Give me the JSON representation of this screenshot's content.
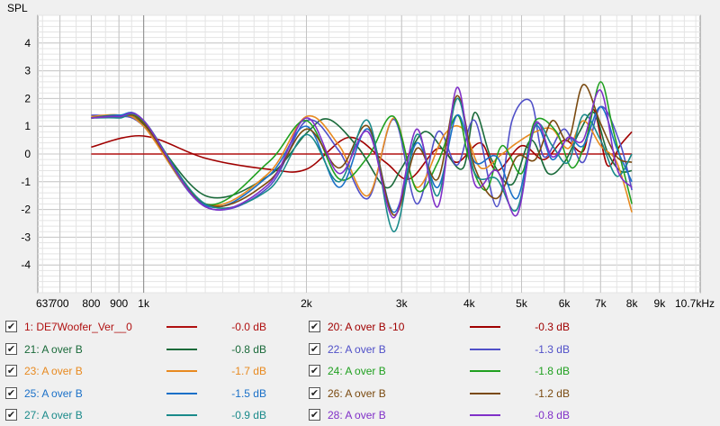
{
  "chart_data": {
    "type": "line",
    "ylabel": "SPL",
    "x_scale": "log",
    "xlim": [
      637,
      10700
    ],
    "ylim": [
      -5,
      5
    ],
    "y_ticks": [
      -4,
      -3,
      -2,
      -1,
      0,
      1,
      2,
      3,
      4
    ],
    "x_ticks": [
      {
        "value": 637,
        "label": "637"
      },
      {
        "value": 700,
        "label": "700"
      },
      {
        "value": 800,
        "label": "800"
      },
      {
        "value": 900,
        "label": "900"
      },
      {
        "value": 1000,
        "label": "1k"
      },
      {
        "value": 2000,
        "label": "2k"
      },
      {
        "value": 3000,
        "label": "3k"
      },
      {
        "value": 4000,
        "label": "4k"
      },
      {
        "value": 5000,
        "label": "5k"
      },
      {
        "value": 6000,
        "label": "6k"
      },
      {
        "value": 7000,
        "label": "7k"
      },
      {
        "value": 8000,
        "label": "8k"
      },
      {
        "value": 9000,
        "label": "9k"
      },
      {
        "value": 10700,
        "label": "10.7kHz"
      }
    ],
    "series": [
      {
        "name": "1: DE7Woofer_Ver__0",
        "color": "#b01010",
        "db": "-0.0 dB",
        "x": [
          800,
          8000
        ],
        "y": [
          0,
          0
        ]
      },
      {
        "name": "20: A over B -10",
        "color": "#a00000",
        "db": "-0.3 dB",
        "x": [
          800,
          1000,
          1300,
          1700,
          2000,
          2400,
          2800,
          3100,
          3500,
          3800,
          4200,
          4500,
          5000,
          5500,
          6000,
          6500,
          6800,
          7200,
          7600,
          8000
        ],
        "y": [
          0.25,
          0.65,
          -0.15,
          -0.55,
          -0.55,
          0.6,
          -0.3,
          -0.9,
          0.2,
          -0.3,
          0.4,
          -0.6,
          0.3,
          -0.2,
          0.5,
          0.1,
          1.6,
          -0.4,
          0.3,
          0.8
        ]
      },
      {
        "name": "21: A over B",
        "color": "#1a6a3a",
        "db": "-0.8 dB",
        "x": [
          800,
          900,
          1000,
          1300,
          1700,
          2000,
          2200,
          2500,
          2800,
          3000,
          3300,
          3600,
          3900,
          4100,
          4400,
          4800,
          5200,
          5600,
          6000,
          6400,
          6800,
          7200,
          7600,
          8000
        ],
        "y": [
          1.3,
          1.35,
          1.05,
          -1.5,
          -0.8,
          0.75,
          1.25,
          0.2,
          -1.2,
          -0.5,
          0.8,
          0.1,
          -0.5,
          1.5,
          -0.2,
          -1.1,
          0.5,
          -0.7,
          -0.3,
          0.8,
          1.5,
          0.1,
          -0.6,
          -0.6
        ]
      },
      {
        "name": "22: A over B",
        "color": "#5050c8",
        "db": "-1.3 dB",
        "x": [
          800,
          880,
          1000,
          1300,
          1700,
          2000,
          2300,
          2600,
          2900,
          3200,
          3500,
          3800,
          4100,
          4500,
          4800,
          5200,
          5500,
          6000,
          6500,
          7000,
          7600,
          8000
        ],
        "y": [
          1.4,
          1.35,
          1.0,
          -1.9,
          -1.2,
          1.2,
          0.1,
          -1.6,
          1.25,
          -1.8,
          0.8,
          -0.4,
          1.2,
          -1.9,
          1.2,
          1.9,
          -0.1,
          0.9,
          -0.3,
          1.7,
          0.4,
          -1.3
        ]
      },
      {
        "name": "23: A over B",
        "color": "#e88a20",
        "db": "-1.7 dB",
        "x": [
          800,
          900,
          1000,
          1300,
          1700,
          2000,
          2300,
          2600,
          2900,
          3200,
          3600,
          3900,
          4200,
          4600,
          4900,
          5300,
          5700,
          6100,
          6500,
          7000,
          7500,
          8000
        ],
        "y": [
          1.35,
          1.4,
          1.0,
          -1.8,
          -0.7,
          1.35,
          0.3,
          -1.5,
          1.3,
          -1.2,
          0.7,
          0.9,
          -0.5,
          0.0,
          0.4,
          0.8,
          0.9,
          0.2,
          1.2,
          0.3,
          -0.3,
          -2.1
        ]
      },
      {
        "name": "24: A over B",
        "color": "#20a020",
        "db": "-1.8 dB",
        "x": [
          800,
          900,
          1000,
          1300,
          1700,
          2000,
          2300,
          2600,
          2900,
          3200,
          3500,
          3800,
          4000,
          4300,
          4600,
          5000,
          5300,
          5800,
          6200,
          6600,
          7000,
          7400,
          8000
        ],
        "y": [
          1.3,
          1.4,
          1.15,
          -1.8,
          -0.3,
          1.2,
          -0.9,
          -0.1,
          1.35,
          -1.3,
          -0.3,
          1.4,
          -0.2,
          -1.3,
          0.3,
          -0.7,
          1.2,
          0.8,
          -0.5,
          0.6,
          2.6,
          0.8,
          -1.8
        ]
      },
      {
        "name": "25: A over B",
        "color": "#1a70c8",
        "db": "-1.5 dB",
        "x": [
          800,
          900,
          1000,
          1300,
          1700,
          2000,
          2300,
          2600,
          2900,
          3200,
          3500,
          3800,
          4100,
          4500,
          4900,
          5300,
          5700,
          6100,
          6500,
          7000,
          7500,
          8000
        ],
        "y": [
          1.3,
          1.4,
          1.2,
          -1.85,
          -0.8,
          1.0,
          -1.2,
          0.9,
          -2.1,
          0.4,
          -1.2,
          1.4,
          -0.3,
          -0.1,
          -1.6,
          1.0,
          -0.2,
          0.6,
          0.3,
          1.7,
          0.2,
          -1.0
        ]
      },
      {
        "name": "26: A over B",
        "color": "#7a4a10",
        "db": "-1.2 dB",
        "x": [
          800,
          900,
          1000,
          1300,
          1700,
          2000,
          2300,
          2600,
          2900,
          3200,
          3500,
          3800,
          4100,
          4500,
          4900,
          5300,
          5700,
          6100,
          6500,
          7000,
          7500,
          8000
        ],
        "y": [
          1.3,
          1.35,
          1.1,
          -1.8,
          -1.0,
          0.9,
          -0.5,
          1.0,
          -2.2,
          0.2,
          -0.9,
          2.1,
          -0.5,
          -1.6,
          -0.1,
          -0.2,
          1.2,
          0.5,
          2.5,
          1.1,
          -0.1,
          -0.3
        ]
      },
      {
        "name": "27: A over B",
        "color": "#1a8a8a",
        "db": "-0.9 dB",
        "x": [
          800,
          900,
          1000,
          1300,
          1700,
          2000,
          2300,
          2600,
          2900,
          3200,
          3500,
          3800,
          4100,
          4500,
          4900,
          5300,
          5700,
          6100,
          6500,
          7000,
          7500,
          8000
        ],
        "y": [
          1.3,
          1.3,
          1.2,
          -1.8,
          -1.3,
          0.7,
          -1.0,
          1.2,
          -2.8,
          0.7,
          -1.5,
          2.0,
          -0.7,
          -0.9,
          -2.0,
          1.0,
          0.3,
          -0.3,
          1.4,
          0.5,
          -0.8,
          0.0
        ]
      },
      {
        "name": "28: A over B",
        "color": "#8030c8",
        "db": "-0.8 dB",
        "x": [
          800,
          900,
          1000,
          1300,
          1700,
          2000,
          2300,
          2600,
          2900,
          3200,
          3500,
          3800,
          4100,
          4500,
          4900,
          5300,
          5700,
          6100,
          6500,
          7000,
          7500,
          8000
        ],
        "y": [
          1.3,
          1.35,
          1.2,
          -1.9,
          -1.1,
          1.3,
          -0.7,
          0.8,
          -2.3,
          0.9,
          -1.9,
          2.4,
          -1.1,
          -0.6,
          -2.2,
          1.1,
          -0.1,
          0.6,
          0.5,
          2.3,
          -0.5,
          -1.2
        ]
      }
    ]
  },
  "legend_order": [
    0,
    1,
    2,
    3,
    4,
    5,
    6,
    7,
    8,
    9
  ]
}
